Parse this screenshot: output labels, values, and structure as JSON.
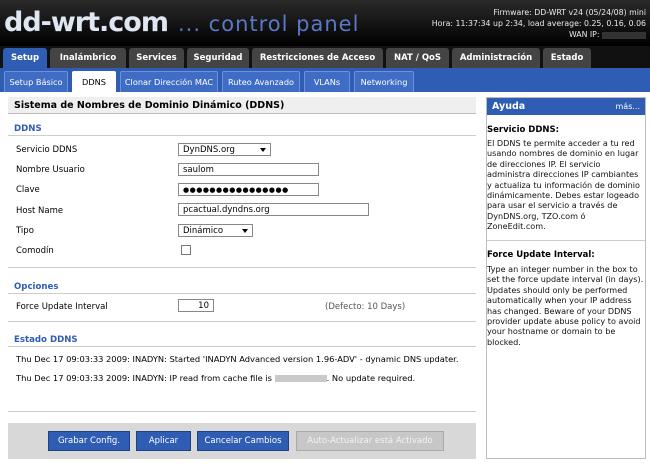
{
  "header": {
    "logo_main": "dd-wrt.com",
    "logo_sub": "... control panel",
    "firmware": "Firmware: DD-WRT v24 (05/24/08) mini",
    "uptime": "Hora: 11:37:34 up 2:34, load average: 0.25, 0.16, 0.06",
    "wan_ip_label": "WAN IP:"
  },
  "main_tabs": [
    "Setup",
    "Inalámbrico",
    "Services",
    "Seguridad",
    "Restricciones de Acceso",
    "NAT / QoS",
    "Administración",
    "Estado"
  ],
  "sub_tabs": [
    "Setup Básico",
    "DDNS",
    "Clonar Dirección MAC",
    "Ruteo Avanzado",
    "VLANs",
    "Networking"
  ],
  "content": {
    "title": "Sistema de Nombres de Dominio Dinámico (DDNS)",
    "ddns_legend": "DDNS",
    "fields": {
      "service": {
        "label": "Servicio DDNS",
        "value": "DynDNS.org"
      },
      "username": {
        "label": "Nombre Usuario",
        "value": "saulom"
      },
      "password": {
        "label": "Clave",
        "value": "●●●●●●●●●●●●●●●●"
      },
      "hostname": {
        "label": "Host Name",
        "value": "pcactual.dyndns.org"
      },
      "type": {
        "label": "Tipo",
        "value": "Dinámico"
      },
      "wildcard": {
        "label": "Comodín",
        "checked": false
      }
    },
    "options_legend": "Opciones",
    "force_update": {
      "label": "Force Update Interval",
      "value": "10",
      "default": "(Defecto: 10 Days)"
    },
    "status_legend": "Estado DDNS",
    "log": [
      "Thu Dec 17 09:03:33 2009: INADYN: Started 'INADYN Advanced version 1.96-ADV' - dynamic DNS updater.",
      "Thu Dec 17 09:03:33 2009: INADYN: IP read from cache file is",
      ". No update required."
    ]
  },
  "buttons": {
    "save": "Grabar Config.",
    "apply": "Aplicar",
    "cancel": "Cancelar Cambios",
    "auto_refresh": "Auto-Actualizar está Activado"
  },
  "help": {
    "title": "Ayuda",
    "more": "más...",
    "sections": [
      {
        "heading": "Servicio DDNS:",
        "text": "El DDNS te permite acceder a tu red usando nombres de dominio en lugar de direcciones IP. El servicio administra direcciones IP cambiantes y actualiza tu información de dominio dinámicamente. Debes estar logeado para usar el servicio a través de DynDNS.org, TZO.com ó ZoneEdit.com."
      },
      {
        "heading": "Force Update Interval:",
        "text": "Type an integer number in the box to set the force update interval (in days). Updates should only be performed automatically when your IP address has changed. Beware of your DDNS provider update abuse policy to avoid your hostname or domain to be blocked."
      }
    ]
  },
  "colors": {
    "accent": "#2f5db3",
    "header_bg": "#111111",
    "legend": "#2f5db3"
  }
}
